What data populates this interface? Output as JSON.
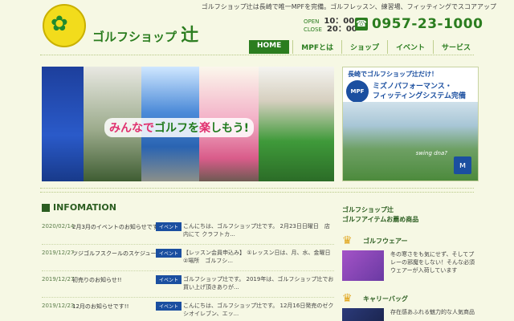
{
  "header": {
    "tagline": "ゴルフショップ辻は長崎で唯一MPFを完備。ゴルフレッスン、練習場、フィッティングでスコアアップ",
    "brand_prefix": "ゴルフショップ",
    "brand_main": "辻",
    "hours": {
      "open_label": "OPEN",
      "open_time": "10：00",
      "close_label": "CLOSE",
      "close_time": "20：00"
    },
    "phone": "0957-23-1000"
  },
  "nav": {
    "items": [
      {
        "label": "HOME",
        "active": true
      },
      {
        "label": "MPFとは"
      },
      {
        "label": "ショップ"
      },
      {
        "label": "イベント"
      },
      {
        "label": "サービス"
      }
    ]
  },
  "hero": {
    "caption_part1": "みんなで",
    "caption_part2": "ゴルフ",
    "caption_part3": "を",
    "caption_part4": "楽",
    "caption_part5": "しもう!"
  },
  "ad": {
    "title": "長崎でゴルフショップ辻だけ！",
    "badge": "MPF",
    "line1": "ミズノパフォーマンス・",
    "line2": "フィッティングシステム完備",
    "swing": "swing dna?"
  },
  "info": {
    "heading": "INFOMATION",
    "news": [
      {
        "date": "2020/02/14",
        "title": "2月3月のイベントのお知らせです",
        "tag": "イベント",
        "desc": "こんにちは、ゴルフショップ辻です。 2月23日日曜日　店内にて クラフトカ..."
      },
      {
        "date": "2019/12/27",
        "title": "ツジゴルフスクールのスケジュール",
        "tag": "イベント",
        "desc": "【レッスン会員申込み】 ①レッスン日は、月、水、金曜日 ②場所　ゴルフシ..."
      },
      {
        "date": "2019/12/27",
        "title": "初売りのお知らせ!!",
        "tag": "イベント",
        "desc": "ゴルフショップ辻です。 2019年は、ゴルフショップ辻でお買い上げ頂きありが..."
      },
      {
        "date": "2019/12/23",
        "title": "12月のお知らせです!!",
        "tag": "イベント",
        "desc": "こんにちは、ゴルフショップ辻です。 12月16日発売のゼクシオイレブン、エッ..."
      }
    ]
  },
  "sidebar": {
    "link1": "ゴルフショップ辻",
    "link2": "ゴルフアイテムお薦め商品",
    "sections": [
      {
        "head": "ゴルフウェアー",
        "body": "冬の寒さをも気にせず、そしてプレーの邪魔をしない！そんな必須ウェアーが入荷しています"
      },
      {
        "head": "キャリーバッグ",
        "body": "存在感あふれる魅力的な人気商品"
      }
    ]
  }
}
